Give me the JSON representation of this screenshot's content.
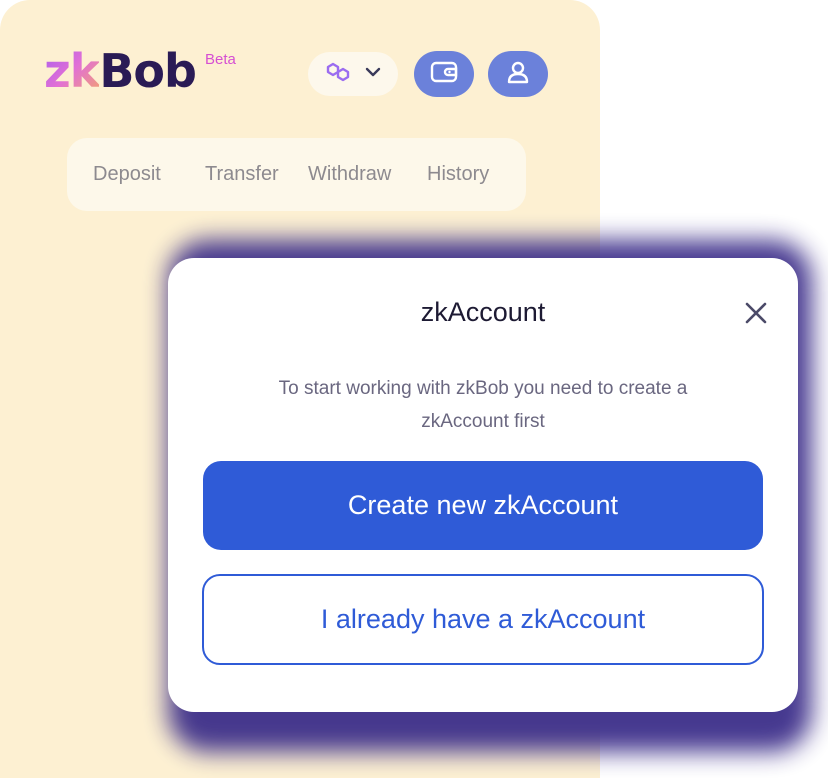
{
  "header": {
    "logo_prefix": "zk",
    "logo_suffix": "Bob",
    "beta_label": "Beta",
    "network_icon": "polygon-icon",
    "dropdown_icon": "chevron-down-icon",
    "wallet_icon": "wallet-icon",
    "account_icon": "user-icon"
  },
  "tabs": [
    {
      "label": "Deposit"
    },
    {
      "label": "Transfer"
    },
    {
      "label": "Withdraw"
    },
    {
      "label": "History"
    }
  ],
  "modal": {
    "title": "zkAccount",
    "close_icon": "close-icon",
    "message_line1": "To start working with zkBob you need to create a",
    "message_line2": "zkAccount first",
    "primary_button": "Create new zkAccount",
    "secondary_button": "I already have a zkAccount"
  },
  "colors": {
    "panel_background": "#fdf0d2",
    "accent_blue": "#2f5bd7",
    "round_button": "#6b81da",
    "brand_dark": "#2a1b55",
    "beta_pink": "#d64fd2"
  }
}
